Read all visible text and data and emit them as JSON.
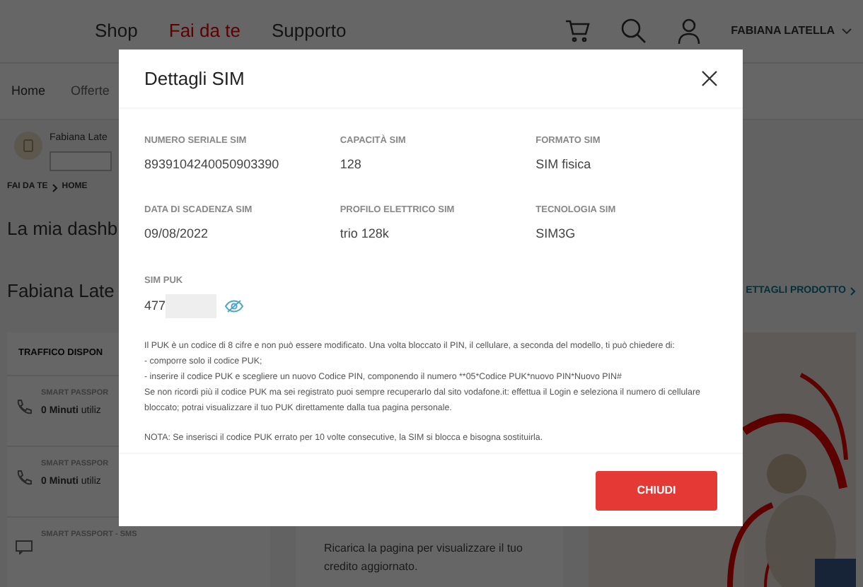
{
  "header": {
    "nav": [
      {
        "label": "Shop",
        "selected": false
      },
      {
        "label": "Fai da te",
        "selected": true
      },
      {
        "label": "Supporto",
        "selected": false
      }
    ],
    "user": "FABIANA LATELLA"
  },
  "subnav": [
    "Home",
    "Offerte"
  ],
  "profile": {
    "name": "Fabiana Late"
  },
  "breadcrumb": [
    "FAI DA TE",
    "HOME"
  ],
  "dashboard_title": "La mia dashb",
  "line_title": "Fabiana Late",
  "product_link": "ETTAGLI PRODOTTO",
  "traffic_card": {
    "title": "TRAFFICO DISPON",
    "rows": [
      {
        "kind": "phone",
        "label": "SMART PASSPOR",
        "value": "0 Minuti",
        "suffix": "utiliz"
      },
      {
        "kind": "phone",
        "label": "SMART PASSPOR",
        "value": "0 Minuti",
        "suffix": "utiliz"
      },
      {
        "kind": "sms",
        "label": "SMART PASSPORT - SMS"
      }
    ]
  },
  "credit_card": {
    "text": "Ricarica la pagina per visualizzare il tuo credito aggiornato."
  },
  "promo": {
    "kind": "picture"
  },
  "dialog": {
    "title": "Dettagli SIM",
    "fields": [
      {
        "label": "NUMERO SERIALE SIM",
        "value": "8939104240050903390"
      },
      {
        "label": "CAPACITÀ SIM",
        "value": "128"
      },
      {
        "label": "FORMATO SIM",
        "value": "SIM fisica"
      },
      {
        "label": "DATA DI SCADENZA SIM",
        "value": "09/08/2022"
      },
      {
        "label": "PROFILO ELETTRICO SIM",
        "value": "trio 128k"
      },
      {
        "label": "TECNOLOGIA SIM",
        "value": "SIM3G"
      }
    ],
    "puk": {
      "label": "SIM PUK",
      "value": "477",
      "hidden": true
    },
    "info": [
      "Il PUK è un codice di 8 cifre e non può essere modificato. Una volta bloccato il PIN, il cellulare, a seconda del modello, ti può chiedere di:",
      "- comporre solo il codice PUK;",
      "- inserire il codice PUK e scegliere un nuovo Codice PIN, componendo il numero **05*Codice PUK*nuovo PIN*Nuovo PIN#",
      "Se non ricordi più il codice PUK ma sei registrato puoi sempre recuperarlo dal sito vodafone.it: effettua il Login e seleziona il numero di cellulare bloccato; potrai visualizzare il tuo PUK direttamente dalla tua pagina personale."
    ],
    "note": "NOTA: Se inserisci il codice PUK errato per 10 volte consecutive, la SIM si blocca e bisogna sostituirla.",
    "button": "CHIUDI"
  }
}
